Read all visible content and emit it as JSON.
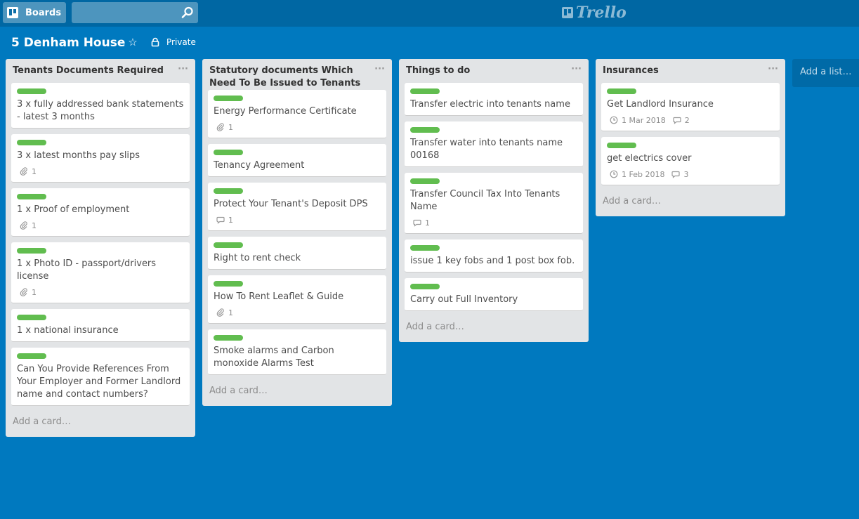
{
  "header": {
    "boards_label": "Boards",
    "search_value": "",
    "logo_text": "Trello"
  },
  "board": {
    "title": "5 Denham House",
    "visibility": "Private"
  },
  "lists": [
    {
      "title": "Tenants Documents Required",
      "menu": "···",
      "add_card": "Add a card…",
      "cards": [
        {
          "title": "3 x fully addressed bank statements - latest 3 months"
        },
        {
          "title": "3 x latest months pay slips",
          "attachments": "1"
        },
        {
          "title": "1 x Proof of employment",
          "attachments": "1"
        },
        {
          "title": "1 x Photo ID - passport/drivers license",
          "attachments": "1"
        },
        {
          "title": "1 x national insurance"
        },
        {
          "title": "Can You Provide References From Your Employer and Former Landlord name and contact numbers?"
        }
      ]
    },
    {
      "title": "Statutory documents Which Need To Be Issued to Tenants",
      "menu": "···",
      "add_card": "Add a card…",
      "cards": [
        {
          "title": "Energy Performance Certificate",
          "attachments": "1"
        },
        {
          "title": "Tenancy Agreement"
        },
        {
          "title": "Protect Your Tenant's Deposit DPS",
          "comments": "1"
        },
        {
          "title": "Right to rent check"
        },
        {
          "title": "How To Rent Leaflet & Guide",
          "attachments": "1"
        },
        {
          "title": "Smoke alarms and Carbon monoxide Alarms Test"
        }
      ]
    },
    {
      "title": "Things to do",
      "menu": "···",
      "add_card": "Add a card…",
      "cards": [
        {
          "title": "Transfer electric into tenants name"
        },
        {
          "title": "Transfer water into tenants name 00168"
        },
        {
          "title": "Transfer Council Tax Into Tenants Name",
          "comments": "1"
        },
        {
          "title": "issue 1 key fobs and 1 post box fob."
        },
        {
          "title": "Carry out Full Inventory"
        }
      ]
    },
    {
      "title": "Insurances",
      "menu": "···",
      "add_card": "Add a card…",
      "cards": [
        {
          "title": "Get Landlord Insurance",
          "due": "1 Mar 2018",
          "comments": "2"
        },
        {
          "title": "get electrics cover",
          "due": "1 Feb 2018",
          "comments": "3"
        }
      ]
    }
  ],
  "add_list": "Add a list…",
  "colors": {
    "background": "#0079bf",
    "header": "#0067a3",
    "label_green": "#61bd4f",
    "list_bg": "#e2e4e6"
  }
}
